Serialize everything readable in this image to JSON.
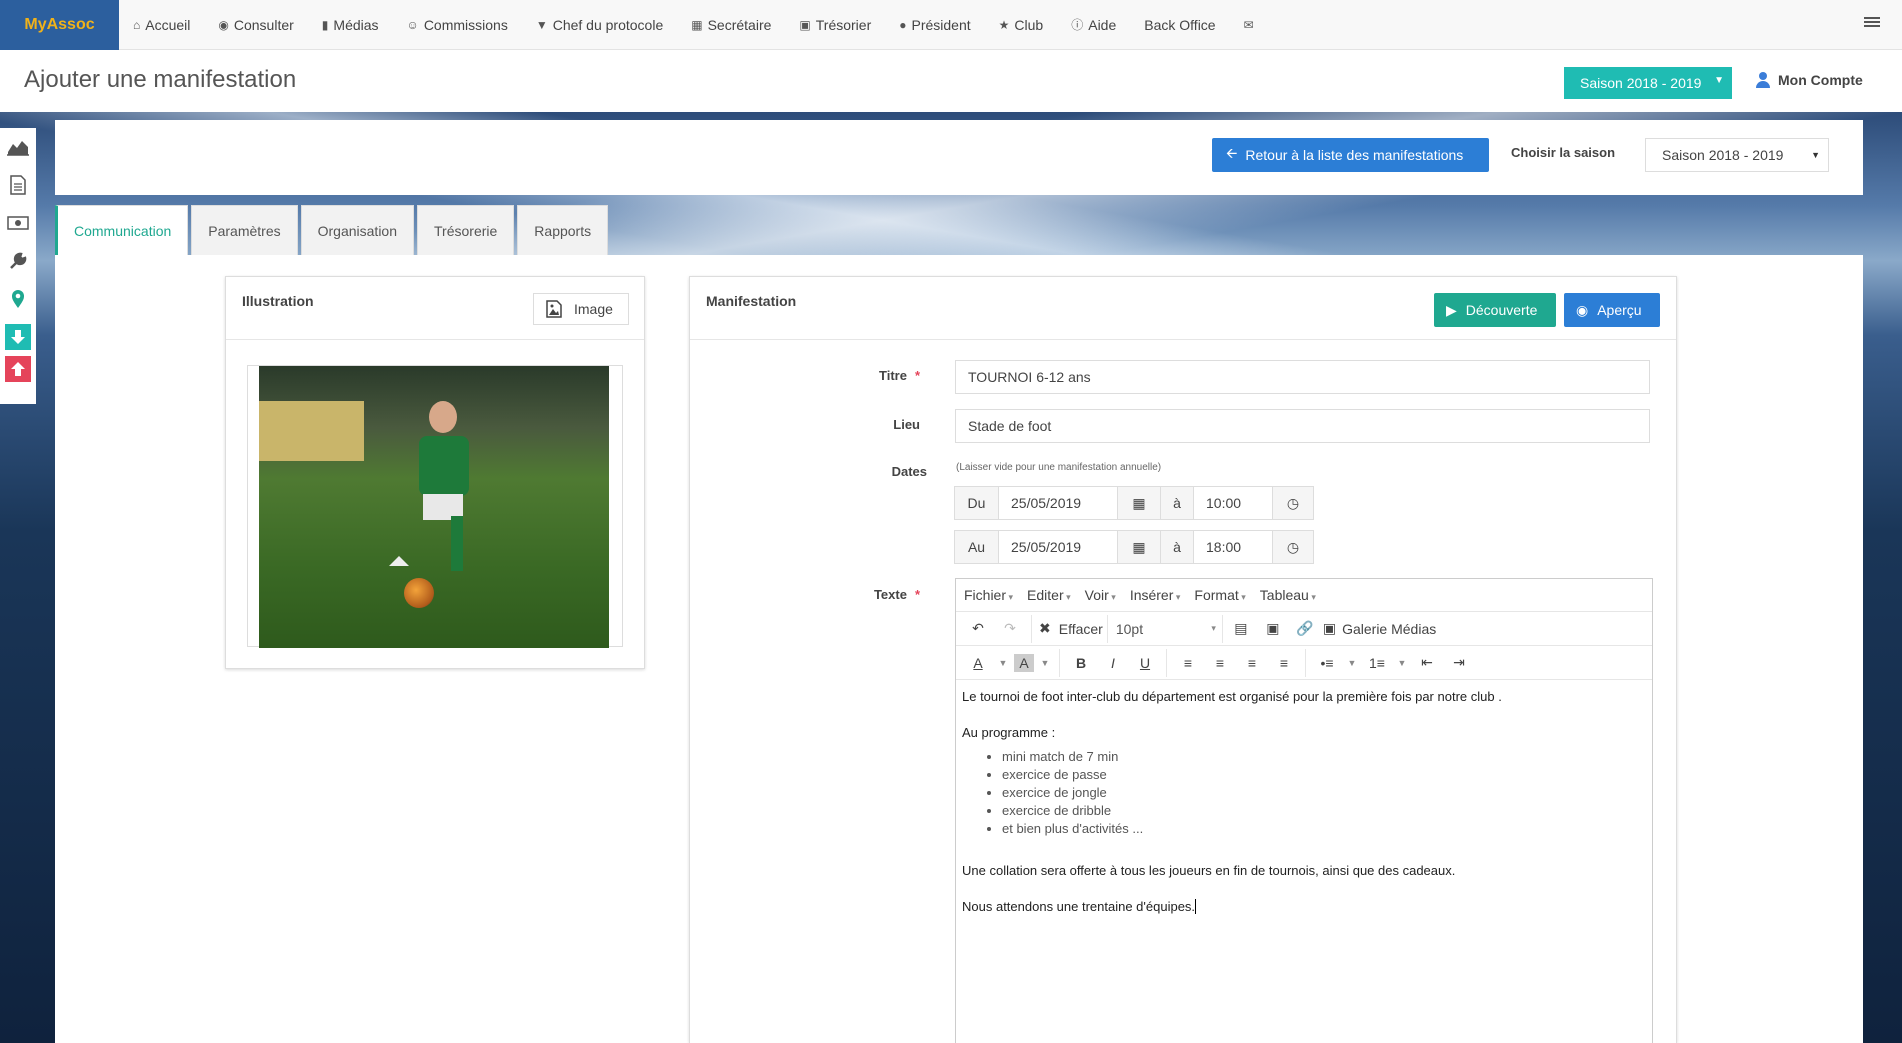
{
  "brand": "MyAssoc",
  "nav": [
    {
      "label": "Accueil",
      "icon": "home-icon"
    },
    {
      "label": "Consulter",
      "icon": "eye-icon"
    },
    {
      "label": "Médias",
      "icon": "file-icon"
    },
    {
      "label": "Commissions",
      "icon": "user-circle-icon"
    },
    {
      "label": "Chef du protocole",
      "icon": "trophy-icon"
    },
    {
      "label": "Secrétaire",
      "icon": "book-icon"
    },
    {
      "label": "Trésorier",
      "icon": "money-icon"
    },
    {
      "label": "Président",
      "icon": "globe-icon"
    },
    {
      "label": "Club",
      "icon": "star-icon"
    },
    {
      "label": "Aide",
      "icon": "info-icon"
    },
    {
      "label": "Back Office",
      "icon": ""
    },
    {
      "label": "",
      "icon": "envelope-icon"
    }
  ],
  "header": {
    "title": "Ajouter une manifestation",
    "season": "Saison 2018 - 2019",
    "account": "Mon Compte"
  },
  "toolbar": {
    "back_label": "Retour à la liste des manifestations",
    "choose_season_label": "Choisir la saison",
    "season_select": "Saison 2018 - 2019"
  },
  "tabs": [
    {
      "label": "Communication",
      "active": true
    },
    {
      "label": "Paramètres",
      "active": false
    },
    {
      "label": "Organisation",
      "active": false
    },
    {
      "label": "Trésorerie",
      "active": false
    },
    {
      "label": "Rapports",
      "active": false
    }
  ],
  "illustration": {
    "title": "Illustration",
    "image_button": "Image"
  },
  "manifestation": {
    "title": "Manifestation",
    "decouverte_label": "Découverte",
    "apercu_label": "Aperçu",
    "titre_label": "Titre",
    "titre_value": "TOURNOI 6-12 ans",
    "lieu_label": "Lieu",
    "lieu_value": "Stade de foot",
    "dates_label": "Dates",
    "dates_hint": "(Laisser vide pour une manifestation annuelle)",
    "du_label": "Du",
    "du_date": "25/05/2019",
    "du_time": "10:00",
    "au_label": "Au",
    "au_date": "25/05/2019",
    "au_time": "18:00",
    "a_label": "à",
    "texte_label": "Texte"
  },
  "editor": {
    "menus": [
      "Fichier",
      "Editer",
      "Voir",
      "Insérer",
      "Format",
      "Tableau"
    ],
    "clear_label": "Effacer",
    "font_size": "10pt",
    "gallery_label": "Galerie Médias",
    "content": {
      "p1": "Le tournoi de foot inter-club du département est organisé pour la première fois par notre club .",
      "p2": "Au programme :",
      "list": [
        "mini match de 7 min",
        "exercice de passe",
        "exercice de jongle",
        "exercice de dribble",
        "et bien plus d'activités ..."
      ],
      "p3": "Une collation sera offerte à tous les joueurs en fin de tournois, ainsi que des cadeaux.",
      "p4": "Nous attendons une trentaine d'équipes."
    }
  },
  "colors": {
    "brand_bg": "#2c5f9e",
    "brand_text": "#f0b21a",
    "teal": "#1fbcb3",
    "primary": "#2c7ed6",
    "success": "#1fa890",
    "danger": "#e5445a"
  }
}
